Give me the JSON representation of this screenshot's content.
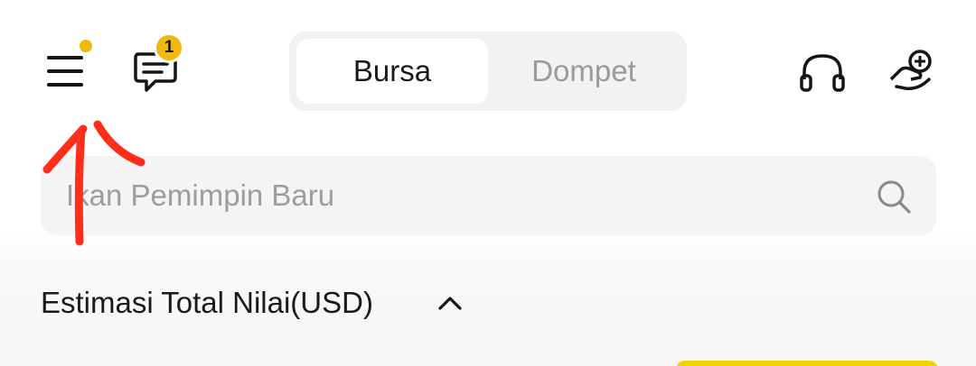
{
  "header": {
    "menu_icon": "hamburger-menu-icon",
    "menu_dot_color": "#f0b90b",
    "messages_icon": "chat-bubble-icon",
    "messages_badge": "1",
    "support_icon": "headset-icon",
    "referral_icon": "referral-hand-icon"
  },
  "tabs": [
    {
      "label": "Bursa",
      "active": true
    },
    {
      "label": "Dompet",
      "active": false
    }
  ],
  "search": {
    "placeholder": "Ikan Pemimpin Baru",
    "icon": "search-icon"
  },
  "total": {
    "label": "Estimasi Total Nilai(USD)",
    "toggle_icon": "chevron-up-icon"
  },
  "colors": {
    "accent": "#f0b90b",
    "annotation": "#ff2d1a",
    "inactive_text": "#9a9a9a"
  }
}
